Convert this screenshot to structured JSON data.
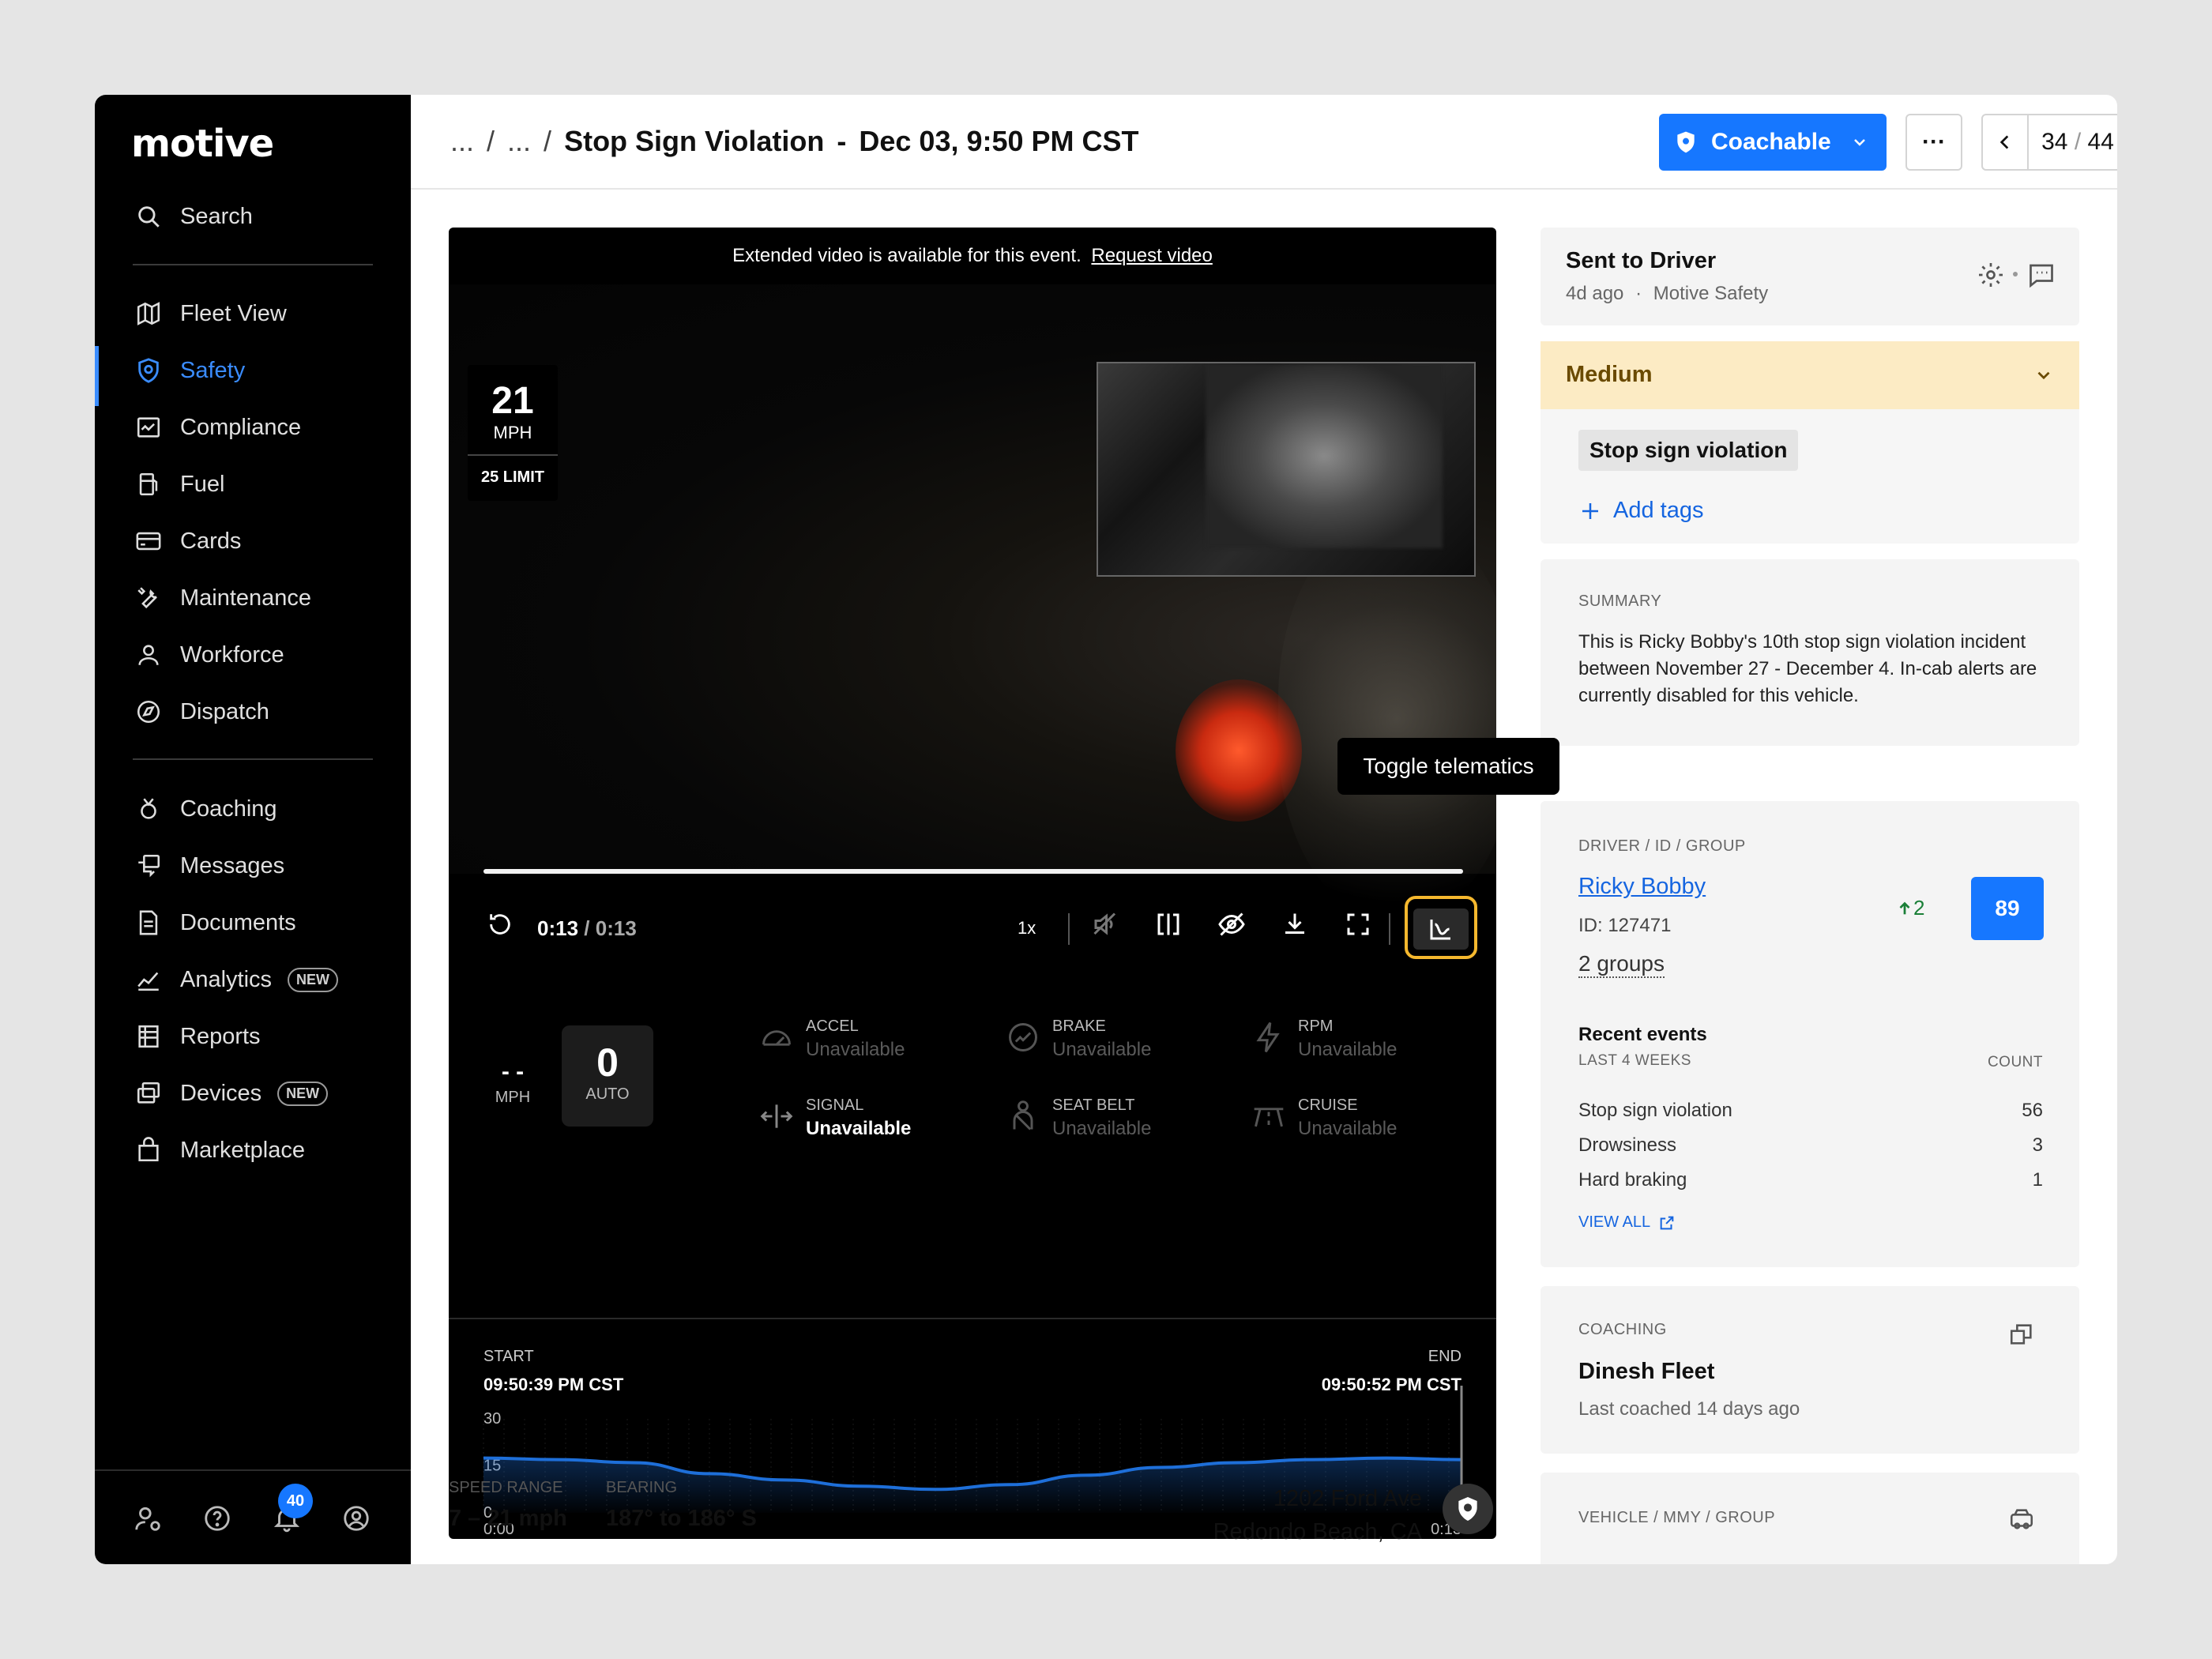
{
  "app": {
    "logo": "motive"
  },
  "sidebar": {
    "search_label": "Search",
    "items": [
      {
        "label": "Fleet View",
        "icon": "map-icon"
      },
      {
        "label": "Safety",
        "icon": "shield-icon",
        "active": true
      },
      {
        "label": "Compliance",
        "icon": "compliance-icon"
      },
      {
        "label": "Fuel",
        "icon": "fuel-icon"
      },
      {
        "label": "Cards",
        "icon": "card-icon"
      },
      {
        "label": "Maintenance",
        "icon": "wrench-icon"
      },
      {
        "label": "Workforce",
        "icon": "person-icon"
      },
      {
        "label": "Dispatch",
        "icon": "dispatch-icon"
      },
      {
        "label": "Coaching",
        "icon": "coaching-icon"
      },
      {
        "label": "Messages",
        "icon": "messages-icon"
      },
      {
        "label": "Documents",
        "icon": "document-icon"
      },
      {
        "label": "Analytics",
        "icon": "analytics-icon",
        "badge": "NEW"
      },
      {
        "label": "Reports",
        "icon": "reports-icon"
      },
      {
        "label": "Devices",
        "icon": "devices-icon",
        "badge": "NEW"
      },
      {
        "label": "Marketplace",
        "icon": "marketplace-icon"
      }
    ],
    "notification_count": "40"
  },
  "header": {
    "crumb_1": "...",
    "crumb_sep": "/",
    "crumb_2": "...",
    "title": "Stop Sign Violation",
    "title_sep": "-",
    "datetime": "Dec 03, 9:50 PM CST",
    "coach_label": "Coachable",
    "more_label": "···",
    "pager_current": "34",
    "pager_sep": "/",
    "pager_total": "44"
  },
  "video": {
    "extended_text": "Extended video is available for this event.",
    "request_link": "Request video",
    "speed_value": "21",
    "speed_unit": "MPH",
    "speed_limit": "25 LIMIT",
    "progress": 1.0,
    "time_current": "0:13",
    "time_sep": "/",
    "time_total": "0:13",
    "playback_rate": "1x",
    "tooltip": "Toggle telematics"
  },
  "telematics": {
    "speed_dash": "- -",
    "speed_unit": "MPH",
    "cruise_value": "0",
    "cruise_mode": "AUTO",
    "stats": [
      {
        "label": "ACCEL",
        "value": "Unavailable",
        "icon": "gauge-icon"
      },
      {
        "label": "BRAKE",
        "value": "Unavailable",
        "icon": "brake-icon"
      },
      {
        "label": "RPM",
        "value": "Unavailable",
        "icon": "bolt-icon"
      },
      {
        "label": "SIGNAL",
        "value": "Unavailable",
        "icon": "signal-icon",
        "highlight": true
      },
      {
        "label": "SEAT BELT",
        "value": "Unavailable",
        "icon": "seatbelt-icon"
      },
      {
        "label": "CRUISE",
        "value": "Unavailable",
        "icon": "cruise-icon"
      }
    ]
  },
  "chart_data": {
    "type": "area",
    "start_label": "START",
    "end_label": "END",
    "start_time": "09:50:39 PM CST",
    "end_time": "09:50:52 PM CST",
    "x_ticks": [
      "0:00",
      "0:13"
    ],
    "y_ticks": [
      "30",
      "15",
      "0"
    ],
    "ylim": [
      0,
      30
    ],
    "x": [
      0,
      1,
      2,
      3,
      4,
      5,
      6,
      7,
      8,
      9,
      10,
      11,
      12,
      13
    ],
    "values": [
      17.5,
      17,
      16,
      12.5,
      10.5,
      8.5,
      7.5,
      9,
      12,
      14.5,
      16,
      17,
      17.5,
      17
    ],
    "color": "#1e6fd9"
  },
  "meta": {
    "speed_range_label": "SPEED RANGE",
    "speed_range": "7 – 21 mph",
    "bearing_label": "BEARING",
    "bearing": "187° to 186° S",
    "address_1": "1202 Ford Ave",
    "address_2": "Redondo Beach, CA"
  },
  "status_card": {
    "title": "Sent to Driver",
    "ago": "4d ago",
    "dot": "·",
    "by": "Motive Safety"
  },
  "severity": {
    "label": "Medium"
  },
  "tags": {
    "tag": "Stop sign violation",
    "add_label": "Add tags"
  },
  "summary": {
    "label": "SUMMARY",
    "text": "This is Ricky Bobby's 10th stop sign violation incident between November 27 - December 4. In-cab alerts are currently disabled for this vehicle."
  },
  "driver": {
    "label": "DRIVER / ID / GROUP",
    "name": "Ricky Bobby",
    "id": "ID: 127471",
    "groups": "2 groups",
    "trend": "2",
    "score": "89",
    "recent_label": "Recent events",
    "period_label": "LAST 4 WEEKS",
    "count_label": "COUNT",
    "events": [
      {
        "name": "Stop sign violation",
        "count": "56"
      },
      {
        "name": "Drowsiness",
        "count": "3"
      },
      {
        "name": "Hard braking",
        "count": "1"
      }
    ],
    "view_all": "VIEW ALL"
  },
  "coaching": {
    "label": "COACHING",
    "name": "Dinesh Fleet",
    "last": "Last coached 14 days ago"
  },
  "vehicle": {
    "label": "VEHICLE / MMY / GROUP"
  },
  "colors": {
    "accent": "#1677ff",
    "severity_bg": "#fcebc4",
    "highlight": "#f5b82e"
  }
}
